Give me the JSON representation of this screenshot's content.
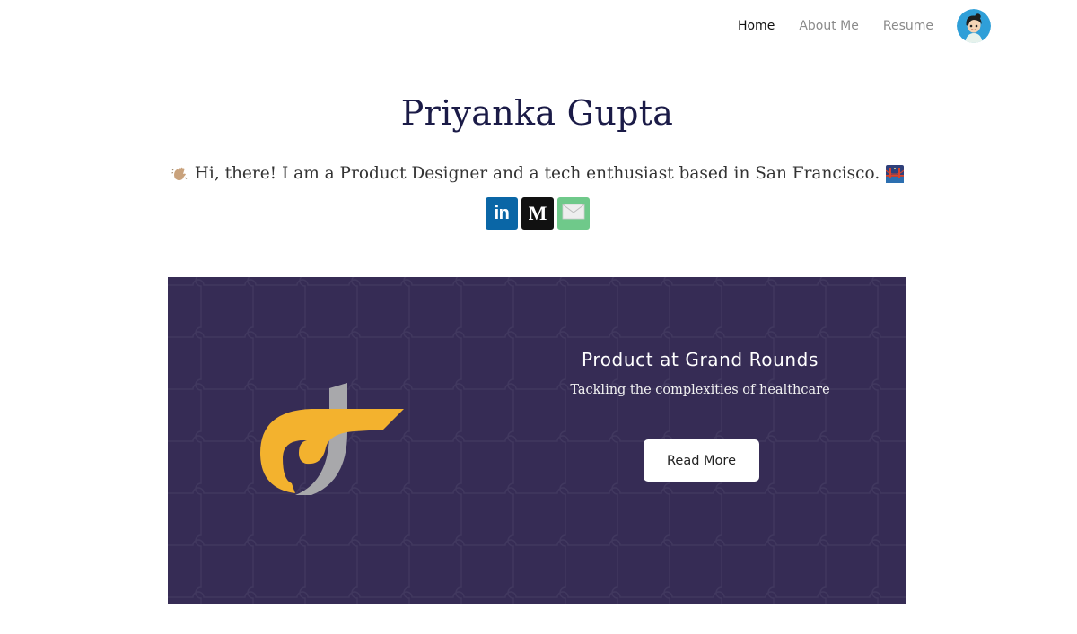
{
  "nav": {
    "items": [
      {
        "label": "Home",
        "active": true
      },
      {
        "label": "About Me",
        "active": false
      },
      {
        "label": "Resume",
        "active": false
      }
    ],
    "avatar_icon": "profile-avatar-icon"
  },
  "hero": {
    "name": "Priyanka Gupta",
    "tagline": "Hi, there! I am a Product Designer and a tech enthusiast based in San Francisco.",
    "tagline_lead_icon": "waving-hand-icon",
    "tagline_trail_icon": "golden-gate-bridge-icon"
  },
  "socials": [
    {
      "name": "linkedin",
      "glyph": "in",
      "icon": "linkedin-icon",
      "color": "#0a66a6"
    },
    {
      "name": "medium",
      "glyph": "M",
      "icon": "medium-icon",
      "color": "#111111"
    },
    {
      "name": "email",
      "glyph": "",
      "icon": "mail-icon",
      "color": "#6fc98a"
    }
  ],
  "card": {
    "title": "Product at Grand Rounds",
    "subtitle": "Tackling the complexities of healthcare",
    "button_label": "Read More",
    "background_color": "#362c55",
    "logo_icon": "grand-rounds-logo-icon",
    "logo_colors": [
      "#f3b22e",
      "#a8a8ab"
    ]
  }
}
